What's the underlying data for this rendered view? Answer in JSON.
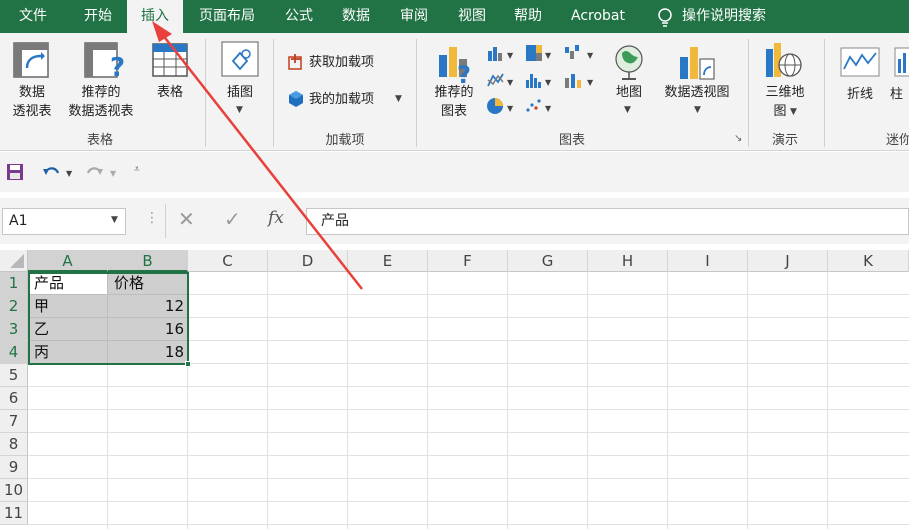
{
  "menu_tabs": [
    "文件",
    "开始",
    "插入",
    "页面布局",
    "公式",
    "数据",
    "审阅",
    "视图",
    "帮助",
    "Acrobat",
    "操作说明搜索"
  ],
  "active_tab": "插入",
  "ribbon": {
    "tables": {
      "pivot_line1": "数据",
      "pivot_line2": "透视表",
      "rec_pivot_line1": "推荐的",
      "rec_pivot_line2": "数据透视表",
      "table": "表格",
      "group": "表格"
    },
    "illustrations": {
      "label": "插图"
    },
    "addins": {
      "get": "获取加载项",
      "mine": "我的加载项",
      "group": "加载项"
    },
    "charts": {
      "rec_line1": "推荐的",
      "rec_line2": "图表",
      "map": "地图",
      "pivot_chart": "数据透视图",
      "group": "图表"
    },
    "tours": {
      "line1": "三维地",
      "line2": "图",
      "group": "演示"
    },
    "sparklines": {
      "line": "折线",
      "col": "柱",
      "group": "迷你"
    }
  },
  "formula_bar": {
    "name_box": "A1",
    "formula": "产品"
  },
  "columns": [
    "A",
    "B",
    "C",
    "D",
    "E",
    "F",
    "G",
    "H",
    "I",
    "J",
    "K"
  ],
  "rows": [
    "1",
    "2",
    "3",
    "4",
    "5",
    "6",
    "7",
    "8",
    "9",
    "10",
    "11"
  ],
  "cells": {
    "A1": "产品",
    "B1": "价格",
    "A2": "甲",
    "B2": "12",
    "A3": "乙",
    "B3": "16",
    "A4": "丙",
    "B4": "18"
  },
  "colors": {
    "excel_green": "#217346",
    "arrow_red": "#e8413b"
  }
}
